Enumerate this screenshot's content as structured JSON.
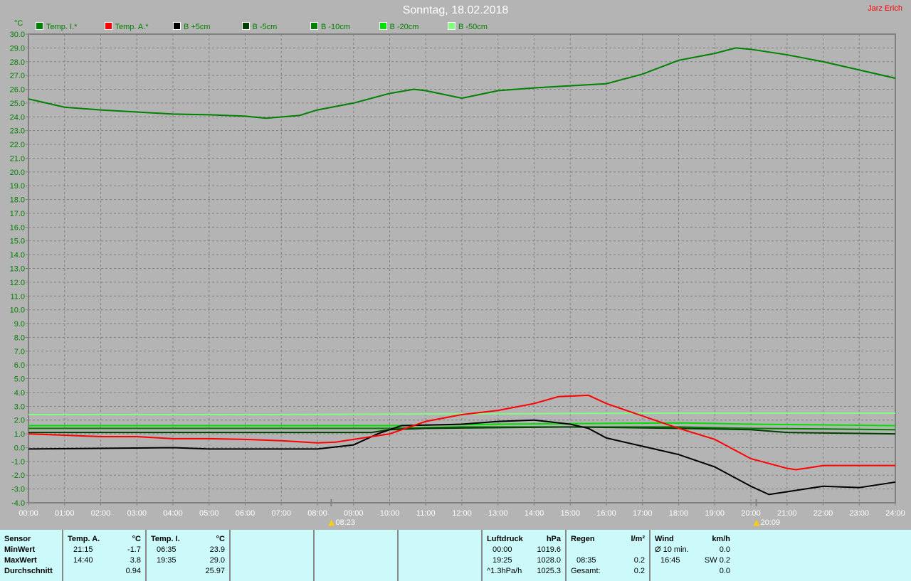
{
  "header": {
    "title": "Sonntag, 18.02.2018",
    "author": "Jarz Erich"
  },
  "chart_data": {
    "type": "line",
    "title": "Sonntag, 18.02.2018",
    "ylabel": "°C",
    "ylim": [
      -4,
      30
    ],
    "xlim": [
      0,
      24
    ],
    "grid": true,
    "xticks": [
      "00:00",
      "01:00",
      "02:00",
      "03:00",
      "04:00",
      "05:00",
      "06:00",
      "07:00",
      "08:00",
      "09:00",
      "10:00",
      "11:00",
      "12:00",
      "13:00",
      "14:00",
      "15:00",
      "16:00",
      "17:00",
      "18:00",
      "19:00",
      "20:00",
      "21:00",
      "22:00",
      "23:00",
      "24:00"
    ],
    "annotations": [
      {
        "type": "sunrise",
        "time": "08:23",
        "x": 8.383
      },
      {
        "type": "sunset",
        "time": "20:09",
        "x": 20.15
      }
    ],
    "series": [
      {
        "name": "Temp. I.*",
        "color": "#008000",
        "x": [
          0,
          1,
          2,
          3,
          4,
          5,
          6,
          6.58,
          7.5,
          8,
          9,
          10,
          10.67,
          11,
          12,
          13,
          14,
          15,
          16,
          17,
          18,
          19,
          19.58,
          20,
          21,
          22,
          23,
          24
        ],
        "y": [
          25.3,
          24.7,
          24.5,
          24.35,
          24.2,
          24.15,
          24.05,
          23.9,
          24.1,
          24.5,
          25.0,
          25.7,
          26.0,
          25.9,
          25.35,
          25.9,
          26.1,
          26.25,
          26.4,
          27.1,
          28.1,
          28.6,
          29.0,
          28.9,
          28.5,
          28.0,
          27.4,
          26.8
        ]
      },
      {
        "name": "Temp. A.*",
        "color": "#ff0000",
        "x": [
          0,
          1,
          2,
          3,
          4,
          5,
          6,
          7,
          8,
          8.5,
          9,
          10,
          11,
          12,
          13,
          14,
          14.67,
          15.5,
          16,
          17,
          18,
          19,
          20,
          21,
          21.25,
          22,
          23,
          24
        ],
        "y": [
          1.0,
          0.9,
          0.8,
          0.8,
          0.65,
          0.65,
          0.6,
          0.5,
          0.35,
          0.4,
          0.6,
          1.0,
          1.9,
          2.4,
          2.7,
          3.2,
          3.7,
          3.8,
          3.2,
          2.3,
          1.4,
          0.6,
          -0.8,
          -1.5,
          -1.6,
          -1.3,
          -1.3,
          -1.3
        ]
      },
      {
        "name": "B +5cm",
        "color": "#000000",
        "x": [
          0,
          4,
          5,
          8,
          9,
          9.67,
          10.33,
          12,
          13,
          14,
          15,
          15.5,
          16,
          17,
          18,
          19,
          20,
          20.5,
          21,
          22,
          23,
          24
        ],
        "y": [
          -0.1,
          0.0,
          -0.1,
          -0.1,
          0.2,
          1.0,
          1.6,
          1.7,
          1.9,
          2.0,
          1.7,
          1.4,
          0.7,
          0.1,
          -0.5,
          -1.4,
          -2.8,
          -3.4,
          -3.2,
          -2.8,
          -2.9,
          -2.5
        ]
      },
      {
        "name": "B -5cm",
        "color": "#004000",
        "x": [
          0,
          9.5,
          10,
          11,
          15,
          18,
          20,
          21,
          24
        ],
        "y": [
          1.1,
          1.1,
          1.3,
          1.4,
          1.5,
          1.4,
          1.3,
          1.1,
          1.0
        ]
      },
      {
        "name": "B -10cm",
        "color": "#008000",
        "x": [
          0,
          10,
          12,
          18,
          20,
          24
        ],
        "y": [
          1.4,
          1.4,
          1.5,
          1.5,
          1.4,
          1.3
        ]
      },
      {
        "name": "B -20cm",
        "color": "#00e000",
        "x": [
          0,
          10,
          13,
          18,
          20,
          24
        ],
        "y": [
          1.6,
          1.6,
          1.7,
          1.8,
          1.7,
          1.6
        ]
      },
      {
        "name": "B -50cm",
        "color": "#80ff80",
        "x": [
          0,
          7,
          12,
          17.5,
          24
        ],
        "y": [
          2.4,
          2.4,
          2.45,
          2.5,
          2.5
        ]
      }
    ]
  },
  "table": {
    "c1": {
      "h": "Sensor",
      "r1": "MinWert",
      "r2": "MaxWert",
      "r3": "Durchschnitt"
    },
    "c2": {
      "h": "Temp. A.",
      "u": "°C",
      "t1": "21:15",
      "v1": "-1.7",
      "t2": "14:40",
      "v2": "3.8",
      "v3": "0.94"
    },
    "c3": {
      "h": "Temp. I.",
      "u": "°C",
      "t1": "06:35",
      "v1": "23.9",
      "t2": "19:35",
      "v2": "29.0",
      "v3": "25.97"
    },
    "c4": {
      "h": "Luftdruck",
      "u": "hPa",
      "t1": "00:00",
      "v1": "1019.6",
      "t2": "19:25",
      "v2": "1028.0",
      "t3": "^1.3hPa/h",
      "v3": "1025.3"
    },
    "c5": {
      "h": "Regen",
      "u": "l/m²",
      "t2": "08:35",
      "v2": "0.2",
      "t3": "Gesamt:",
      "v3": "0.2"
    },
    "c6": {
      "h": "Wind",
      "u": "km/h",
      "t1": "Ø 10 min.",
      "v1": "0.0",
      "t2": "16:45",
      "v2": "SW 0.2",
      "v3": "0.0"
    }
  }
}
